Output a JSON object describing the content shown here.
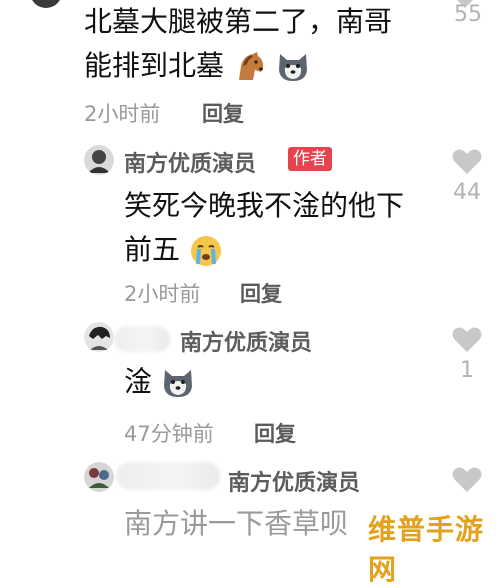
{
  "comments": [
    {
      "text_line1": "北墓大腿被第二了，南哥",
      "text_line2": "能排到北墓",
      "emojis": [
        "horse-emoji",
        "husky-emoji"
      ],
      "time": "2小时前",
      "reply_label": "回复",
      "like_count": "55"
    },
    {
      "username": "南方优质演员",
      "badge": "作者",
      "text_line1": "笑死今晚我不淦的他下",
      "text_line2": "前五",
      "emojis": [
        "crying-emoji"
      ],
      "time": "2小时前",
      "reply_label": "回复",
      "like_count": "44"
    },
    {
      "username": "南方优质演员",
      "text": "淦",
      "emojis": [
        "husky-emoji"
      ],
      "time": "47分钟前",
      "reply_label": "回复",
      "like_count": "1"
    },
    {
      "username": "南方优质演员",
      "text": "南方讲一下香草呗"
    }
  ],
  "watermark": "维普手游网",
  "colors": {
    "author_badge": "#e8424f",
    "heart": "#c8c8c8",
    "watermark": "#e3a11c"
  }
}
